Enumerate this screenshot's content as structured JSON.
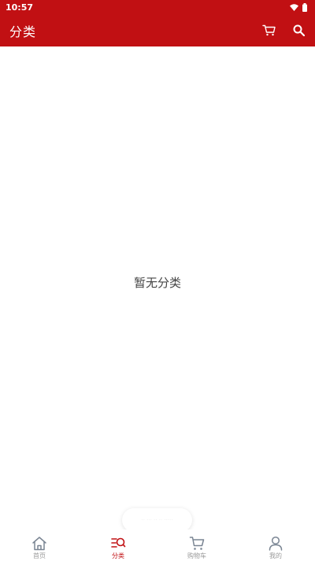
{
  "status_bar": {
    "time": "10:57"
  },
  "app_bar": {
    "title": "分类"
  },
  "content": {
    "empty_message": "暂无分类"
  },
  "toast": {
    "text": "·· ··· ·· ·· ·····"
  },
  "tab_bar": {
    "active_index": 1,
    "tabs": [
      {
        "label": "首页",
        "icon": "home-icon"
      },
      {
        "label": "分类",
        "icon": "category-icon"
      },
      {
        "label": "购物车",
        "icon": "cart-icon"
      },
      {
        "label": "我的",
        "icon": "person-icon"
      }
    ]
  },
  "colors": {
    "brand": "#c11013",
    "inactive": "#9a9a9a",
    "text": "#444444"
  }
}
